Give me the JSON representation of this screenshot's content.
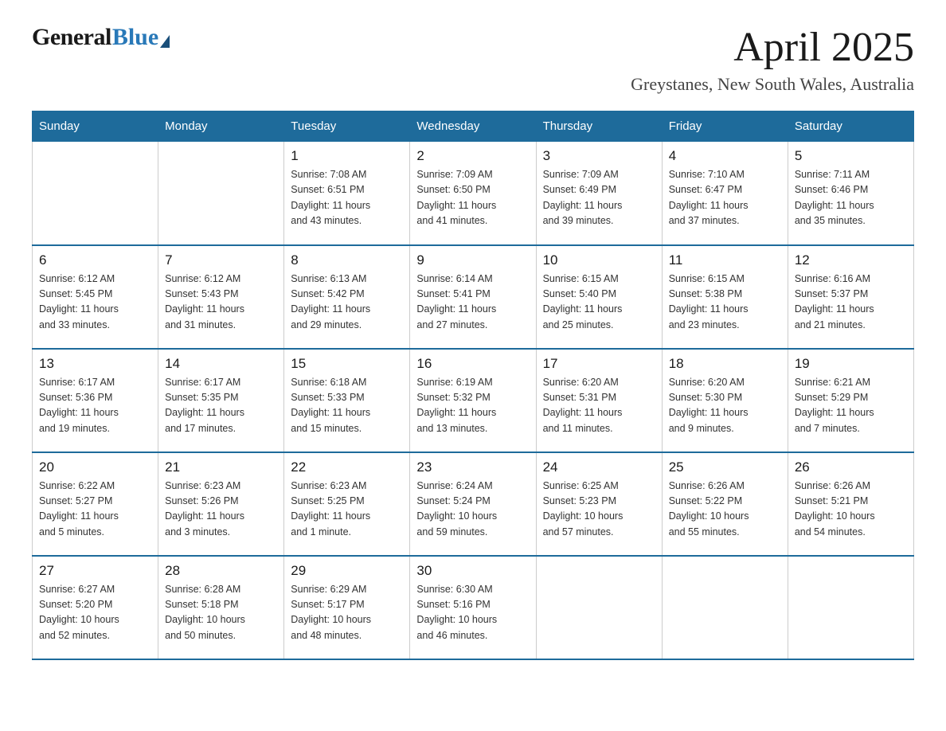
{
  "logo": {
    "general": "General",
    "blue": "Blue"
  },
  "title": {
    "month": "April 2025",
    "location": "Greystanes, New South Wales, Australia"
  },
  "weekdays": [
    "Sunday",
    "Monday",
    "Tuesday",
    "Wednesday",
    "Thursday",
    "Friday",
    "Saturday"
  ],
  "weeks": [
    [
      {
        "day": "",
        "info": ""
      },
      {
        "day": "",
        "info": ""
      },
      {
        "day": "1",
        "info": "Sunrise: 7:08 AM\nSunset: 6:51 PM\nDaylight: 11 hours\nand 43 minutes."
      },
      {
        "day": "2",
        "info": "Sunrise: 7:09 AM\nSunset: 6:50 PM\nDaylight: 11 hours\nand 41 minutes."
      },
      {
        "day": "3",
        "info": "Sunrise: 7:09 AM\nSunset: 6:49 PM\nDaylight: 11 hours\nand 39 minutes."
      },
      {
        "day": "4",
        "info": "Sunrise: 7:10 AM\nSunset: 6:47 PM\nDaylight: 11 hours\nand 37 minutes."
      },
      {
        "day": "5",
        "info": "Sunrise: 7:11 AM\nSunset: 6:46 PM\nDaylight: 11 hours\nand 35 minutes."
      }
    ],
    [
      {
        "day": "6",
        "info": "Sunrise: 6:12 AM\nSunset: 5:45 PM\nDaylight: 11 hours\nand 33 minutes."
      },
      {
        "day": "7",
        "info": "Sunrise: 6:12 AM\nSunset: 5:43 PM\nDaylight: 11 hours\nand 31 minutes."
      },
      {
        "day": "8",
        "info": "Sunrise: 6:13 AM\nSunset: 5:42 PM\nDaylight: 11 hours\nand 29 minutes."
      },
      {
        "day": "9",
        "info": "Sunrise: 6:14 AM\nSunset: 5:41 PM\nDaylight: 11 hours\nand 27 minutes."
      },
      {
        "day": "10",
        "info": "Sunrise: 6:15 AM\nSunset: 5:40 PM\nDaylight: 11 hours\nand 25 minutes."
      },
      {
        "day": "11",
        "info": "Sunrise: 6:15 AM\nSunset: 5:38 PM\nDaylight: 11 hours\nand 23 minutes."
      },
      {
        "day": "12",
        "info": "Sunrise: 6:16 AM\nSunset: 5:37 PM\nDaylight: 11 hours\nand 21 minutes."
      }
    ],
    [
      {
        "day": "13",
        "info": "Sunrise: 6:17 AM\nSunset: 5:36 PM\nDaylight: 11 hours\nand 19 minutes."
      },
      {
        "day": "14",
        "info": "Sunrise: 6:17 AM\nSunset: 5:35 PM\nDaylight: 11 hours\nand 17 minutes."
      },
      {
        "day": "15",
        "info": "Sunrise: 6:18 AM\nSunset: 5:33 PM\nDaylight: 11 hours\nand 15 minutes."
      },
      {
        "day": "16",
        "info": "Sunrise: 6:19 AM\nSunset: 5:32 PM\nDaylight: 11 hours\nand 13 minutes."
      },
      {
        "day": "17",
        "info": "Sunrise: 6:20 AM\nSunset: 5:31 PM\nDaylight: 11 hours\nand 11 minutes."
      },
      {
        "day": "18",
        "info": "Sunrise: 6:20 AM\nSunset: 5:30 PM\nDaylight: 11 hours\nand 9 minutes."
      },
      {
        "day": "19",
        "info": "Sunrise: 6:21 AM\nSunset: 5:29 PM\nDaylight: 11 hours\nand 7 minutes."
      }
    ],
    [
      {
        "day": "20",
        "info": "Sunrise: 6:22 AM\nSunset: 5:27 PM\nDaylight: 11 hours\nand 5 minutes."
      },
      {
        "day": "21",
        "info": "Sunrise: 6:23 AM\nSunset: 5:26 PM\nDaylight: 11 hours\nand 3 minutes."
      },
      {
        "day": "22",
        "info": "Sunrise: 6:23 AM\nSunset: 5:25 PM\nDaylight: 11 hours\nand 1 minute."
      },
      {
        "day": "23",
        "info": "Sunrise: 6:24 AM\nSunset: 5:24 PM\nDaylight: 10 hours\nand 59 minutes."
      },
      {
        "day": "24",
        "info": "Sunrise: 6:25 AM\nSunset: 5:23 PM\nDaylight: 10 hours\nand 57 minutes."
      },
      {
        "day": "25",
        "info": "Sunrise: 6:26 AM\nSunset: 5:22 PM\nDaylight: 10 hours\nand 55 minutes."
      },
      {
        "day": "26",
        "info": "Sunrise: 6:26 AM\nSunset: 5:21 PM\nDaylight: 10 hours\nand 54 minutes."
      }
    ],
    [
      {
        "day": "27",
        "info": "Sunrise: 6:27 AM\nSunset: 5:20 PM\nDaylight: 10 hours\nand 52 minutes."
      },
      {
        "day": "28",
        "info": "Sunrise: 6:28 AM\nSunset: 5:18 PM\nDaylight: 10 hours\nand 50 minutes."
      },
      {
        "day": "29",
        "info": "Sunrise: 6:29 AM\nSunset: 5:17 PM\nDaylight: 10 hours\nand 48 minutes."
      },
      {
        "day": "30",
        "info": "Sunrise: 6:30 AM\nSunset: 5:16 PM\nDaylight: 10 hours\nand 46 minutes."
      },
      {
        "day": "",
        "info": ""
      },
      {
        "day": "",
        "info": ""
      },
      {
        "day": "",
        "info": ""
      }
    ]
  ],
  "colors": {
    "header_bg": "#1e6b9b",
    "header_text": "#ffffff",
    "border": "#1e6b9b",
    "cell_border": "#cccccc"
  }
}
